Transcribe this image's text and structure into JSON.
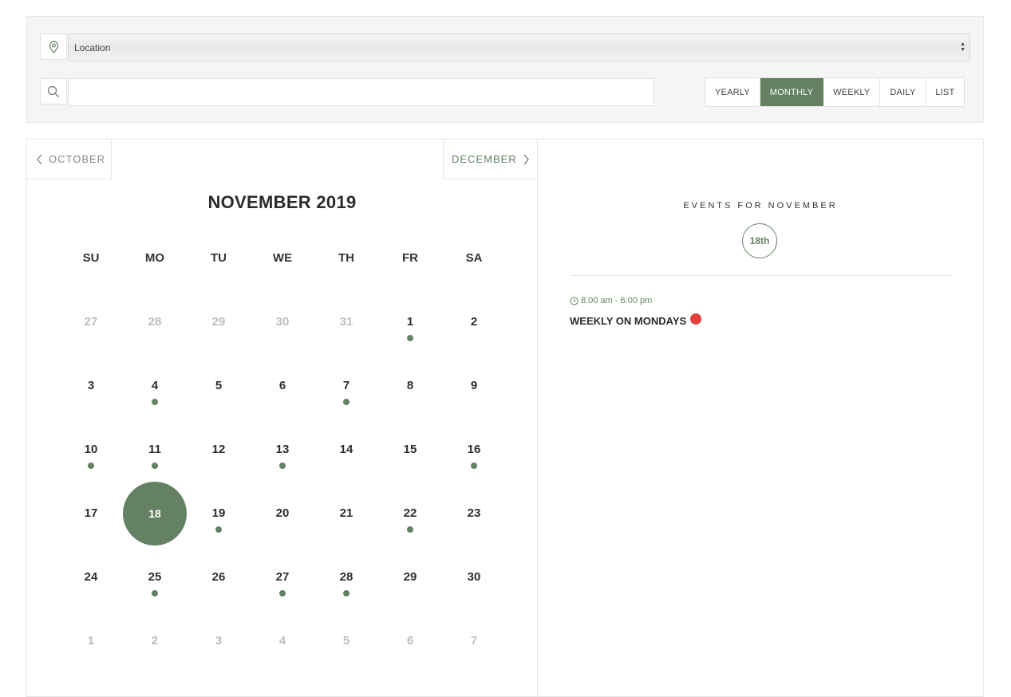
{
  "filters": {
    "location_label": "Location",
    "search_value": "",
    "views": [
      {
        "label": "YEARLY",
        "active": false
      },
      {
        "label": "MONTHLY",
        "active": true
      },
      {
        "label": "WEEKLY",
        "active": false
      },
      {
        "label": "DAILY",
        "active": false
      },
      {
        "label": "LIST",
        "active": false
      }
    ]
  },
  "calendar": {
    "prev_label": "OCTOBER",
    "next_label": "DECEMBER",
    "title": "NOVEMBER 2019",
    "weekdays": [
      "SU",
      "MO",
      "TU",
      "WE",
      "TH",
      "FR",
      "SA"
    ],
    "weeks": [
      [
        {
          "d": "27",
          "other": true
        },
        {
          "d": "28",
          "other": true
        },
        {
          "d": "29",
          "other": true
        },
        {
          "d": "30",
          "other": true
        },
        {
          "d": "31",
          "other": true
        },
        {
          "d": "1",
          "dot": true
        },
        {
          "d": "2"
        }
      ],
      [
        {
          "d": "3"
        },
        {
          "d": "4",
          "dot": true
        },
        {
          "d": "5"
        },
        {
          "d": "6"
        },
        {
          "d": "7",
          "dot": true
        },
        {
          "d": "8"
        },
        {
          "d": "9"
        }
      ],
      [
        {
          "d": "10",
          "dot": true
        },
        {
          "d": "11",
          "dot": true
        },
        {
          "d": "12"
        },
        {
          "d": "13",
          "dot": true
        },
        {
          "d": "14"
        },
        {
          "d": "15"
        },
        {
          "d": "16",
          "dot": true
        }
      ],
      [
        {
          "d": "17"
        },
        {
          "d": "18",
          "selected": true
        },
        {
          "d": "19",
          "dot": true
        },
        {
          "d": "20"
        },
        {
          "d": "21"
        },
        {
          "d": "22",
          "dot": true
        },
        {
          "d": "23"
        }
      ],
      [
        {
          "d": "24"
        },
        {
          "d": "25",
          "dot": true
        },
        {
          "d": "26"
        },
        {
          "d": "27",
          "dot": true
        },
        {
          "d": "28",
          "dot": true
        },
        {
          "d": "29"
        },
        {
          "d": "30"
        }
      ],
      [
        {
          "d": "1",
          "other": true
        },
        {
          "d": "2",
          "other": true
        },
        {
          "d": "3",
          "other": true
        },
        {
          "d": "4",
          "other": true
        },
        {
          "d": "5",
          "other": true
        },
        {
          "d": "6",
          "other": true
        },
        {
          "d": "7",
          "other": true
        }
      ]
    ]
  },
  "events": {
    "heading": "EVENTS FOR NOVEMBER",
    "selected_date": "18th",
    "items": [
      {
        "time": "8:00 am - 6:00 pm",
        "title": "WEEKLY ON MONDAYS"
      }
    ]
  },
  "colors": {
    "accent": "#648263",
    "event_marker": "#e0413c",
    "muted_day": "#bcbcbc"
  }
}
